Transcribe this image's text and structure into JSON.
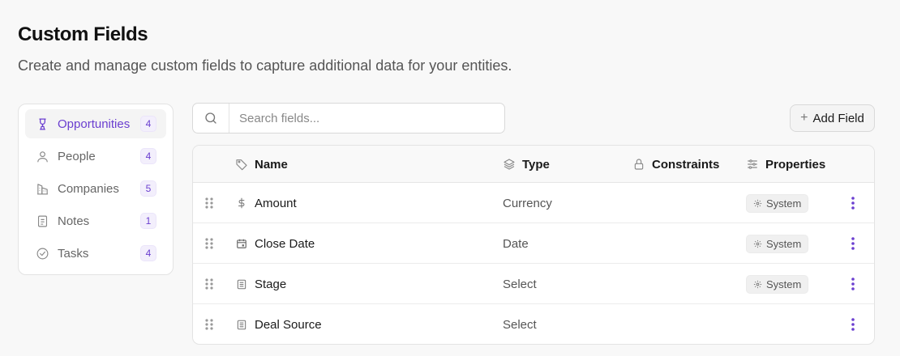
{
  "header": {
    "title": "Custom Fields",
    "subtitle": "Create and manage custom fields to capture additional data for your entities."
  },
  "sidebar": {
    "items": [
      {
        "label": "Opportunities",
        "count": "4",
        "icon": "trophy-icon",
        "active": true
      },
      {
        "label": "People",
        "count": "4",
        "icon": "person-icon",
        "active": false
      },
      {
        "label": "Companies",
        "count": "5",
        "icon": "building-icon",
        "active": false
      },
      {
        "label": "Notes",
        "count": "1",
        "icon": "note-icon",
        "active": false
      },
      {
        "label": "Tasks",
        "count": "4",
        "icon": "check-circle-icon",
        "active": false
      }
    ]
  },
  "search": {
    "placeholder": "Search fields..."
  },
  "toolbar": {
    "add_label": "Add Field"
  },
  "table": {
    "columns": {
      "name": "Name",
      "type": "Type",
      "constraints": "Constraints",
      "properties": "Properties"
    },
    "rows": [
      {
        "name": "Amount",
        "type": "Currency",
        "badge": "System",
        "icon": "dollar-icon"
      },
      {
        "name": "Close Date",
        "type": "Date",
        "badge": "System",
        "icon": "calendar-icon"
      },
      {
        "name": "Stage",
        "type": "Select",
        "badge": "System",
        "icon": "list-icon"
      },
      {
        "name": "Deal Source",
        "type": "Select",
        "badge": "",
        "icon": "list-icon"
      }
    ]
  },
  "colors": {
    "accent": "#6b3fd0",
    "count_bg": "#f3effc"
  }
}
